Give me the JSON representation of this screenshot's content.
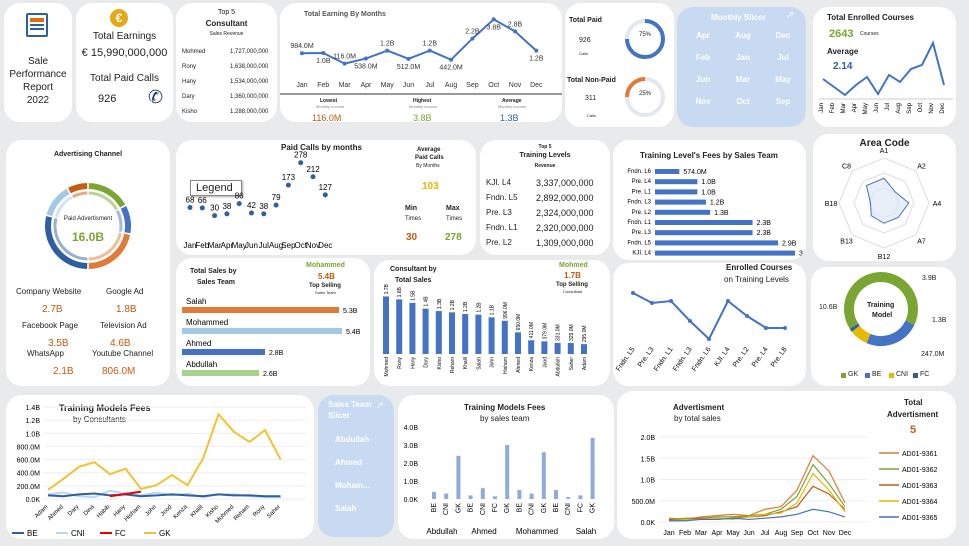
{
  "title": {
    "line1": "Sale",
    "line2": "Performance",
    "line3": "Report",
    "line4": "2022"
  },
  "kpi": {
    "earnings_label": "Total Earnings",
    "earnings_value": "€ 15,990,000,000",
    "paid_calls_label": "Total Paid Calls",
    "paid_calls_value": "926"
  },
  "top5_consultant": {
    "top": "Top 5",
    "title": "Consultant",
    "sub": "Sales Revenue",
    "rows": [
      {
        "name": "Mohmed",
        "value": "1,727,000,000"
      },
      {
        "name": "Rony",
        "value": "1,638,000,000"
      },
      {
        "name": "Hany",
        "value": "1,534,000,000"
      },
      {
        "name": "Dary",
        "value": "1,360,000,000"
      },
      {
        "name": "Kisho",
        "value": "1,288,000,000"
      }
    ]
  },
  "earning_by_months": {
    "title": "Total Earning By Months",
    "months": [
      "Jan",
      "Feb",
      "Mar",
      "Apr",
      "May",
      "Jun",
      "Jul",
      "Aug",
      "Sep",
      "Oct",
      "Nov",
      "Dec"
    ],
    "labels": [
      "984.0M",
      "1.0B",
      "116.0M",
      "538.0M",
      "1.2B",
      "512.0M",
      "1.2B",
      "442.0M",
      "2.2B",
      "3.8B",
      "2.8B",
      "1.2B"
    ],
    "values": [
      984,
      1000,
      116,
      538,
      1200,
      512,
      1200,
      442,
      2200,
      3800,
      2800,
      1200
    ],
    "lowest_label": "Lowest",
    "highest_label": "Highest",
    "average_label": "Average",
    "monthly_sub": "Monthly Income",
    "lowest": "116.0M",
    "highest": "3.8B",
    "average": "1.3B"
  },
  "paid_status": {
    "paid_label": "Total Paid",
    "paid_value": "926",
    "paid_unit": "Calls",
    "paid_pct": "75%",
    "paid_frac": 0.75,
    "nonpaid_label": "Total Non-Paid",
    "nonpaid_value": "311",
    "nonpaid_unit": "Calls",
    "nonpaid_pct": "25%",
    "nonpaid_frac": 0.25
  },
  "monthly_slicer": {
    "title": "Monthly Slicer",
    "items": [
      "Apr",
      "Aug",
      "Dec",
      "Feb",
      "Jan",
      "Jul",
      "Jun",
      "Mar",
      "May",
      "Nov",
      "Oct",
      "Sep"
    ]
  },
  "enrolled": {
    "title": "Total Enrolled Courses",
    "value": "2643",
    "unit": "Courses",
    "avg_label": "Average",
    "avg_value": "2.14",
    "months": [
      "Jan",
      "Feb",
      "Mar",
      "Apr",
      "May",
      "Jun",
      "Jul",
      "Aug",
      "Sep",
      "Oct",
      "Nov",
      "Dec"
    ]
  },
  "advertising_channel": {
    "title": "Advertising Channel",
    "center_label": "Paid Advertisment",
    "center_value": "16.0B",
    "items": [
      {
        "name": "Company Website",
        "value": "2.7B"
      },
      {
        "name": "Google Ad",
        "value": "1.8B"
      },
      {
        "name": "Facebook Page",
        "value": "3.5B"
      },
      {
        "name": "Television Ad",
        "value": "4.6B"
      },
      {
        "name": "WhatsApp",
        "value": "2.1B"
      },
      {
        "name": "Youtube Channel",
        "value": "806.0M"
      }
    ]
  },
  "paid_calls_months": {
    "title": "Paid Calls by months",
    "legend": "Legend",
    "months": [
      "Jan",
      "Feb",
      "Mar",
      "Apr",
      "May",
      "Jun",
      "Jul",
      "Aug",
      "Sep",
      "Oct",
      "Nov",
      "Dec"
    ],
    "values": [
      68,
      66,
      30,
      38,
      86,
      42,
      38,
      79,
      173,
      278,
      212,
      127
    ],
    "avg_label": "Average",
    "avg_sub1": "Paid Calls",
    "avg_sub2": "By Months",
    "avg_value": "103",
    "min_label": "Min",
    "max_label": "Max",
    "times": "Times",
    "min_value": "30",
    "max_value": "278"
  },
  "top5_levels": {
    "top": "Top 5",
    "title": "Training Levels",
    "sub": "Revenue",
    "rows": [
      {
        "name": "KJI. L4",
        "value": "3,337,000,000"
      },
      {
        "name": "Fndn. L5",
        "value": "2,892,000,000"
      },
      {
        "name": "Pre. L3",
        "value": "2,324,000,000"
      },
      {
        "name": "Fndn. L1",
        "value": "2,320,000,000"
      },
      {
        "name": "Pre. L2",
        "value": "1,309,000,000"
      }
    ]
  },
  "level_fees": {
    "title": "Training Level's Fees by Sales Team",
    "rows": [
      {
        "name": "Fndn. L6",
        "label": "574.0M",
        "v": 574
      },
      {
        "name": "Pre. L4",
        "label": "1.0B",
        "v": 1000
      },
      {
        "name": "Pre. L1",
        "label": "1.0B",
        "v": 1000
      },
      {
        "name": "Fndn. L3",
        "label": "1.2B",
        "v": 1200
      },
      {
        "name": "Pre. L2",
        "label": "1.3B",
        "v": 1300
      },
      {
        "name": "Fndn. L1",
        "label": "2.3B",
        "v": 2300
      },
      {
        "name": "Pre. L3",
        "label": "2.3B",
        "v": 2300
      },
      {
        "name": "Fndn. L5",
        "label": "2.9B",
        "v": 2900
      },
      {
        "name": "KJI. L4",
        "label": "3.3B",
        "v": 3300
      }
    ]
  },
  "area_code": {
    "title": "Area Code",
    "labels": [
      "A1",
      "A2",
      "A4",
      "A7",
      "B12",
      "B13",
      "B18",
      "C8"
    ]
  },
  "sales_team": {
    "title": "Total Sales by",
    "title2": "Sales Team",
    "top_name": "Mohammed",
    "top_value": "5.4B",
    "top_label": "Top Selling",
    "top_sub": "Sales Team",
    "rows": [
      {
        "name": "Salah",
        "label": "5.3B",
        "v": 5.3
      },
      {
        "name": "Mohammed",
        "label": "5.4B",
        "v": 5.4
      },
      {
        "name": "Ahmed",
        "label": "2.8B",
        "v": 2.8
      },
      {
        "name": "Abdullah",
        "label": "2.6B",
        "v": 2.6
      }
    ]
  },
  "consultant_sales": {
    "title": "Consultant by",
    "title2": "Total Sales",
    "top_name": "Mohmed",
    "top_value": "1.7B",
    "top_label": "Top Selling",
    "top_sub": "Consultant",
    "names": [
      "Mohmed",
      "Rony",
      "Hany",
      "Dary",
      "Kisho",
      "Reham",
      "Khalil",
      "Salah",
      "John",
      "Hisham",
      "Ahmed",
      "Kenza",
      "Jood",
      "Abdullah",
      "Saher",
      "Adam"
    ],
    "labels": [
      "1.7B",
      "1.6B",
      "1.5B",
      "1.4B",
      "1.3B",
      "1.2B",
      "1.2B",
      "1.2B",
      "1.1B",
      "996.0M",
      "650.0M",
      "411.0M",
      "379.0M",
      "331.0M",
      "329.0M",
      "295.0M"
    ],
    "values": [
      1727,
      1638,
      1534,
      1360,
      1288,
      1250,
      1200,
      1180,
      1100,
      996,
      650,
      411,
      379,
      331,
      329,
      295
    ]
  },
  "enrolled_levels": {
    "title": "Enrolled Courses",
    "title2": "on Training Levels",
    "labels": [
      "Fndn. L5",
      "Pre. L3",
      "Fndn. L1",
      "Fndn. L3",
      "Fndn. L6",
      "KJI. L4",
      "Pre. L2",
      "Pre. L4",
      "Pre. L8"
    ]
  },
  "training_model": {
    "center": "Training",
    "center2": "Model",
    "labels": [
      "3.9B",
      "1.3B",
      "247.0M",
      "10.6B"
    ],
    "legend": [
      "GK",
      "BE",
      "CNI",
      "FC"
    ],
    "values": [
      10.6,
      3.9,
      1.3,
      0.247
    ]
  },
  "models_by_consultant": {
    "title": "Training Models Fees",
    "sub": "by Consultants",
    "yticks": [
      "1.4B",
      "1.2B",
      "1.0B",
      "800.0M",
      "600.0M",
      "400.0M",
      "200.0M",
      "0.0K"
    ],
    "names": [
      "Adam",
      "Ahmed",
      "Dary",
      "Dina",
      "Habib",
      "Hany",
      "Hisham",
      "John",
      "Jood",
      "Kenza",
      "Khalil",
      "Kisho",
      "Mohmed",
      "Reham",
      "Rony",
      "Saher"
    ],
    "series": [
      {
        "name": "BE"
      },
      {
        "name": "CNI"
      },
      {
        "name": "FC"
      },
      {
        "name": "GK"
      }
    ]
  },
  "sales_team_slicer": {
    "title": "Sales Team",
    "title2": "Slicer",
    "items": [
      "Abdullah",
      "Ahmed",
      "Moham...",
      "Salah"
    ]
  },
  "models_by_team": {
    "title": "Training Models Fees",
    "sub": "by sales team",
    "yticks": [
      "4.0B",
      "3.0B",
      "2.0B",
      "1.0B",
      "0.0K"
    ],
    "cats": [
      "BE",
      "CNI",
      "GK",
      "BE",
      "CNI",
      "FC",
      "GK",
      "BE",
      "CNI",
      "GK",
      "BE",
      "CNI",
      "FC",
      "GK"
    ],
    "values": [
      0.4,
      0.3,
      2.4,
      0.2,
      0.6,
      0.15,
      3.0,
      0.5,
      0.3,
      2.6,
      0.5,
      0.1,
      0.2,
      3.4
    ],
    "groups": [
      "Abdullah",
      "Ahmed",
      "Mohammed",
      "Salah"
    ]
  },
  "advertisment": {
    "title": "Advertisment",
    "sub": "by total sales",
    "total_label": "Total",
    "total_label2": "Advertisment",
    "total_value": "5",
    "yticks": [
      "2.0B",
      "1.5B",
      "1.0B",
      "500.0M",
      "0.0K"
    ],
    "months": [
      "Jan",
      "Feb",
      "Mar",
      "Apr",
      "May",
      "Jun",
      "Jul",
      "Aug",
      "Sep",
      "Oct",
      "Nov",
      "Dec"
    ],
    "series": [
      {
        "name": "AD01-9361",
        "color": "#e07b39"
      },
      {
        "name": "AD01-9362",
        "color": "#7aa533"
      },
      {
        "name": "AD01-9363",
        "color": "#c55a11"
      },
      {
        "name": "AD01-9364",
        "color": "#e6b800"
      },
      {
        "name": "AD01-9365",
        "color": "#4472c4"
      }
    ]
  }
}
